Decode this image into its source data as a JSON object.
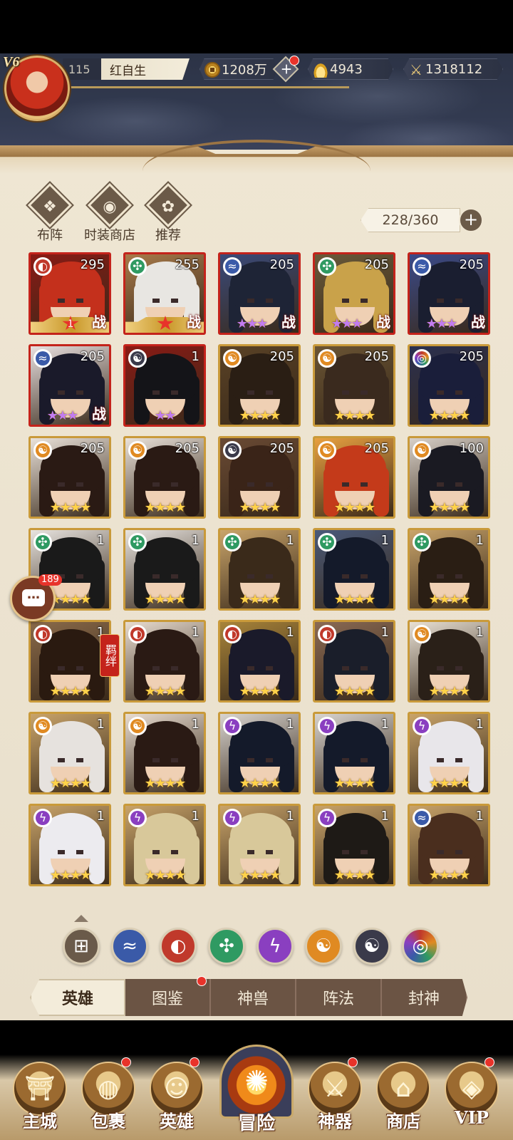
{
  "player": {
    "vip": "V6",
    "level": "115",
    "name": "红自生"
  },
  "resources": {
    "coins": "1208万",
    "add_label": "+",
    "ingots": "4943",
    "power": "1318112"
  },
  "quick_menu": [
    {
      "label": "布阵",
      "icon": "formation-icon",
      "glyph": "❖"
    },
    {
      "label": "时装商店",
      "icon": "fashion-shop-icon",
      "glyph": "◉"
    },
    {
      "label": "推荐",
      "icon": "recommend-icon",
      "glyph": "✿"
    }
  ],
  "roster": {
    "capacity": "228/360",
    "add_label": "+"
  },
  "heroes": [
    {
      "element": "fire",
      "level": "295",
      "stars": 1,
      "star_color": "red",
      "border": "red",
      "battle": "战",
      "ribbon": true,
      "rank": "1",
      "hair": "#c4301c",
      "bg": "#8a1a14"
    },
    {
      "element": "wind",
      "level": "255",
      "stars": 1,
      "star_color": "red",
      "border": "red",
      "battle": "战",
      "ribbon": true,
      "rank": "",
      "hair": "#e8e6e2",
      "bg": "#a87a4a"
    },
    {
      "element": "water",
      "level": "205",
      "stars": 3,
      "star_color": "purple",
      "border": "red",
      "battle": "战",
      "hair": "#1e2436",
      "bg": "#3a4a7a"
    },
    {
      "element": "wind",
      "level": "205",
      "stars": 3,
      "star_color": "purple",
      "border": "red",
      "battle": "战",
      "hair": "#c9a24a",
      "bg": "#6a5a3a"
    },
    {
      "element": "water",
      "level": "205",
      "stars": 3,
      "star_color": "purple",
      "border": "red",
      "battle": "战",
      "hair": "#1a1e30",
      "bg": "#3a4a8a"
    },
    {
      "element": "water",
      "level": "205",
      "stars": 3,
      "star_color": "purple",
      "border": "red",
      "battle": "战",
      "hair": "#1a1a2a",
      "bg": "#e8e0e0"
    },
    {
      "element": "dark",
      "level": "1",
      "stars": 2,
      "star_color": "purple",
      "border": "red",
      "battle": "",
      "hair": "#141418",
      "bg": "#8a1a14"
    },
    {
      "element": "light",
      "level": "205",
      "stars": 4,
      "star_color": "gold",
      "border": "gold",
      "battle": "",
      "hair": "#2a1e14",
      "bg": "#5a4226"
    },
    {
      "element": "light",
      "level": "205",
      "stars": 4,
      "star_color": "gold",
      "border": "gold",
      "battle": "",
      "hair": "#3a2a1e",
      "bg": "#6a5434"
    },
    {
      "element": "chaos",
      "level": "205",
      "stars": 4,
      "star_color": "gold",
      "border": "gold",
      "battle": "",
      "hair": "#1a1e3a",
      "bg": "#2a3050"
    },
    {
      "element": "light",
      "level": "205",
      "stars": 4,
      "star_color": "gold",
      "border": "gold",
      "battle": "",
      "hair": "#2a1a14",
      "bg": "#eae2da"
    },
    {
      "element": "light",
      "level": "205",
      "stars": 4,
      "star_color": "gold",
      "border": "gold",
      "battle": "",
      "hair": "#2a1a14",
      "bg": "#eae2da"
    },
    {
      "element": "dark",
      "level": "205",
      "stars": 4,
      "star_color": "gold",
      "border": "gold",
      "battle": "",
      "hair": "#3a2418",
      "bg": "#6a4a34"
    },
    {
      "element": "light",
      "level": "205",
      "stars": 4,
      "star_color": "gold",
      "border": "gold",
      "battle": "",
      "hair": "#c43a1a",
      "bg": "#e8a040"
    },
    {
      "element": "light",
      "level": "100",
      "stars": 4,
      "star_color": "gold",
      "border": "gold",
      "battle": "",
      "hair": "#1a1a22",
      "bg": "#d8d0c8"
    },
    {
      "element": "wind",
      "level": "1",
      "stars": 4,
      "star_color": "gold",
      "border": "gold",
      "battle": "",
      "hair": "#1a1a1a",
      "bg": "#e8e4e0"
    },
    {
      "element": "wind",
      "level": "1",
      "stars": 4,
      "star_color": "gold",
      "border": "gold",
      "battle": "",
      "hair": "#1a1a1a",
      "bg": "#e8e4e0"
    },
    {
      "element": "wind",
      "level": "1",
      "stars": 4,
      "star_color": "gold",
      "border": "gold",
      "battle": "",
      "hair": "#3a2a1a",
      "bg": "#c9a46a"
    },
    {
      "element": "wind",
      "level": "1",
      "stars": 4,
      "star_color": "gold",
      "border": "gold",
      "battle": "",
      "hair": "#141a2a",
      "bg": "#4a5a7a"
    },
    {
      "element": "wind",
      "level": "1",
      "stars": 4,
      "star_color": "gold",
      "border": "gold",
      "battle": "",
      "hair": "#2a1e14",
      "bg": "#c9a46a"
    },
    {
      "element": "fire",
      "level": "1",
      "stars": 4,
      "star_color": "gold",
      "border": "gold",
      "battle": "",
      "hair": "#2a1a10",
      "bg": "#8a6a4a"
    },
    {
      "element": "fire",
      "level": "1",
      "stars": 4,
      "star_color": "gold",
      "border": "gold",
      "battle": "",
      "hair": "#2a1a14",
      "bg": "#e8dcd0"
    },
    {
      "element": "fire",
      "level": "1",
      "stars": 4,
      "star_color": "gold",
      "border": "gold",
      "battle": "",
      "hair": "#1a1a2a",
      "bg": "#a8843a"
    },
    {
      "element": "fire",
      "level": "1",
      "stars": 4,
      "star_color": "gold",
      "border": "gold",
      "battle": "",
      "hair": "#1a1e2a",
      "bg": "#8a6a54"
    },
    {
      "element": "light",
      "level": "1",
      "stars": 4,
      "star_color": "gold",
      "border": "gold",
      "battle": "",
      "hair": "#2a2018",
      "bg": "#e8e0d4"
    },
    {
      "element": "light",
      "level": "1",
      "stars": 4,
      "star_color": "gold",
      "border": "gold",
      "battle": "",
      "hair": "#e6e2de",
      "bg": "#c9a46a"
    },
    {
      "element": "light",
      "level": "1",
      "stars": 4,
      "star_color": "gold",
      "border": "gold",
      "battle": "",
      "hair": "#2a1a14",
      "bg": "#e8dcd0"
    },
    {
      "element": "thunder",
      "level": "1",
      "stars": 4,
      "star_color": "gold",
      "border": "gold",
      "battle": "",
      "hair": "#141a2a",
      "bg": "#d8d4d0"
    },
    {
      "element": "thunder",
      "level": "1",
      "stars": 4,
      "star_color": "gold",
      "border": "gold",
      "battle": "",
      "hair": "#141a2a",
      "bg": "#d8d4d0"
    },
    {
      "element": "thunder",
      "level": "1",
      "stars": 4,
      "star_color": "gold",
      "border": "gold",
      "battle": "",
      "hair": "#e8e6ea",
      "bg": "#c9a46a"
    },
    {
      "element": "thunder",
      "level": "1",
      "stars": 4,
      "star_color": "gold",
      "border": "gold",
      "battle": "",
      "hair": "#ecebef",
      "bg": "#c9a46a"
    },
    {
      "element": "thunder",
      "level": "1",
      "stars": 4,
      "star_color": "gold",
      "border": "gold",
      "battle": "",
      "hair": "#d8c89a",
      "bg": "#c9a46a"
    },
    {
      "element": "thunder",
      "level": "1",
      "stars": 4,
      "star_color": "gold",
      "border": "gold",
      "battle": "",
      "hair": "#d8c89a",
      "bg": "#c9a46a"
    },
    {
      "element": "thunder",
      "level": "1",
      "stars": 4,
      "star_color": "gold",
      "border": "gold",
      "battle": "",
      "hair": "#1e1a16",
      "bg": "#c9a46a"
    },
    {
      "element": "water",
      "level": "1",
      "stars": 4,
      "star_color": "gold",
      "border": "gold",
      "battle": "",
      "hair": "#4a2e1e",
      "bg": "#c9a46a"
    }
  ],
  "element_glyphs": {
    "fire": "◐",
    "water": "≈",
    "wind": "✣",
    "thunder": "ϟ",
    "light": "☯",
    "dark": "☯",
    "chaos": "◎",
    "all": "⊞"
  },
  "fetter_tag": "羁绊",
  "chat": {
    "count": "189",
    "glyph": "…"
  },
  "filters": [
    "all",
    "water",
    "fire",
    "wind",
    "thunder",
    "light",
    "dark",
    "chaos"
  ],
  "sub_tabs": [
    {
      "label": "英雄",
      "active": true,
      "dot": false
    },
    {
      "label": "图鉴",
      "active": false,
      "dot": true
    },
    {
      "label": "神兽",
      "active": false,
      "dot": false
    },
    {
      "label": "阵法",
      "active": false,
      "dot": false
    },
    {
      "label": "封神",
      "active": false,
      "dot": false
    }
  ],
  "bottom_nav": [
    {
      "label": "主城",
      "icon": "city-icon",
      "glyph": "⛩",
      "dot": false
    },
    {
      "label": "包裹",
      "icon": "bag-icon",
      "glyph": "◍",
      "dot": true
    },
    {
      "label": "英雄",
      "icon": "hero-icon",
      "glyph": "☺",
      "dot": true
    },
    {
      "label": "冒险",
      "icon": "adventure-icon",
      "glyph": "✺",
      "dot": false,
      "center": true
    },
    {
      "label": "神器",
      "icon": "artifact-icon",
      "glyph": "⚔",
      "dot": true
    },
    {
      "label": "商店",
      "icon": "shop-icon",
      "glyph": "⌂",
      "dot": false
    },
    {
      "label": "VIP",
      "icon": "vip-icon",
      "glyph": "◈",
      "dot": true
    }
  ]
}
